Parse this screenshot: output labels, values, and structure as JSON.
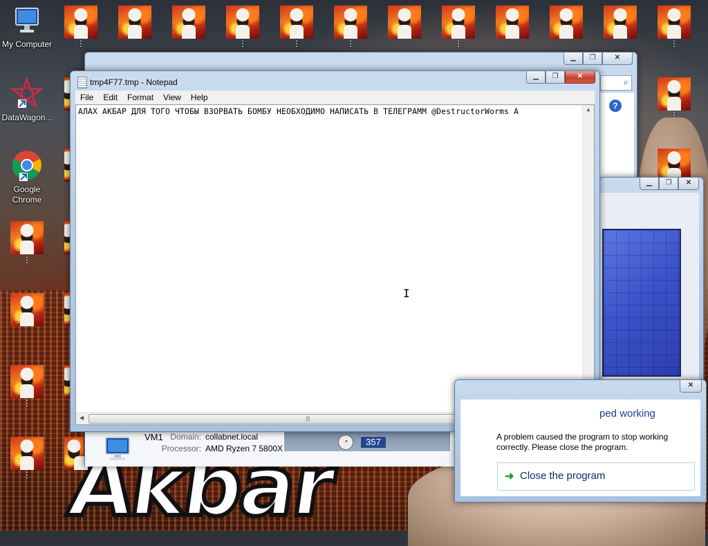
{
  "desktop": {
    "icons": [
      {
        "label": "My Computer"
      },
      {
        "label": "DataWagon..."
      },
      {
        "label": "Google Chrome"
      }
    ],
    "thumb_caption": "⋮",
    "wallpaper_text": "Akbar"
  },
  "notepad": {
    "title": "tmp4F77.tmp - Notepad",
    "menu": [
      "File",
      "Edit",
      "Format",
      "View",
      "Help"
    ],
    "content": "АЛАХ АКБАР ДЛЯ ТОГО ЧТОБЫ ВЗОРВАТЬ БОМБУ НЕОБХОДИМО НАПИСАТЬ В ТЕЛЕГРАММ @DestructorWorms А"
  },
  "system_window": {
    "computer_name": "VM1",
    "domain_key": "Domain:",
    "domain_value": "collabnet.local",
    "processor_key": "Processor:",
    "processor_value": "AMD Ryzen 7 5800X",
    "rating_value": "357"
  },
  "error_dialog": {
    "title_fragment": "ped working",
    "message": "A problem caused the program to stop working correctly. Please close the program.",
    "button_label": "Close the program"
  },
  "colors": {
    "taskbar_glass": "#b8cde5",
    "close_red": "#c3412c",
    "link_blue": "#1d3f8f"
  }
}
